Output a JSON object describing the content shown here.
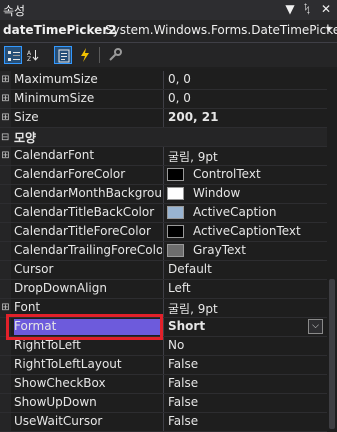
{
  "window": {
    "title": "속성",
    "dropdown_glyph": "▼",
    "pin_glyph": "ᛪ",
    "close_glyph": "✕"
  },
  "object": {
    "name": "dateTimePicker2",
    "type": "System.Windows.Forms.DateTimePicker",
    "dropdown_glyph": "▾"
  },
  "toolbar": {
    "icons": [
      "categorized-icon",
      "alphabetical-icon",
      "properties-icon",
      "events-icon",
      "property-pages-icon"
    ]
  },
  "rows": [
    {
      "type": "prop",
      "name": "MaximumSize",
      "value": "0, 0",
      "expandable": true
    },
    {
      "type": "prop",
      "name": "MinimumSize",
      "value": "0, 0",
      "expandable": true
    },
    {
      "type": "prop",
      "name": "Size",
      "value": "200, 21",
      "expandable": true,
      "bold": true
    },
    {
      "type": "category",
      "name": "모양"
    },
    {
      "type": "prop",
      "name": "CalendarFont",
      "value": "굴림, 9pt",
      "expandable": true
    },
    {
      "type": "color",
      "name": "CalendarForeColor",
      "value": "ControlText",
      "swatch": "#000000"
    },
    {
      "type": "color",
      "name": "CalendarMonthBackground",
      "value": "Window",
      "swatch": "#ffffff"
    },
    {
      "type": "color",
      "name": "CalendarTitleBackColor",
      "value": "ActiveCaption",
      "swatch": "#99b4d1"
    },
    {
      "type": "color",
      "name": "CalendarTitleForeColor",
      "value": "ActiveCaptionText",
      "swatch": "#000000"
    },
    {
      "type": "color",
      "name": "CalendarTrailingForeColor",
      "value": "GrayText",
      "swatch": "#6d6d6d"
    },
    {
      "type": "prop",
      "name": "Cursor",
      "value": "Default"
    },
    {
      "type": "prop",
      "name": "DropDownAlign",
      "value": "Left"
    },
    {
      "type": "prop",
      "name": "Font",
      "value": "굴림, 9pt",
      "expandable": true
    },
    {
      "type": "prop",
      "name": "Format",
      "value": "Short",
      "bold": true,
      "selected": true,
      "dropdown": "⌵"
    },
    {
      "type": "prop",
      "name": "RightToLeft",
      "value": "No"
    },
    {
      "type": "prop",
      "name": "RightToLeftLayout",
      "value": "False"
    },
    {
      "type": "prop",
      "name": "ShowCheckBox",
      "value": "False"
    },
    {
      "type": "prop",
      "name": "ShowUpDown",
      "value": "False"
    },
    {
      "type": "prop",
      "name": "UseWaitCursor",
      "value": "False"
    }
  ],
  "colors": {
    "selection": "#6d5bdc",
    "highlight_box": "#e2212a",
    "background": "#1e1e1e"
  }
}
